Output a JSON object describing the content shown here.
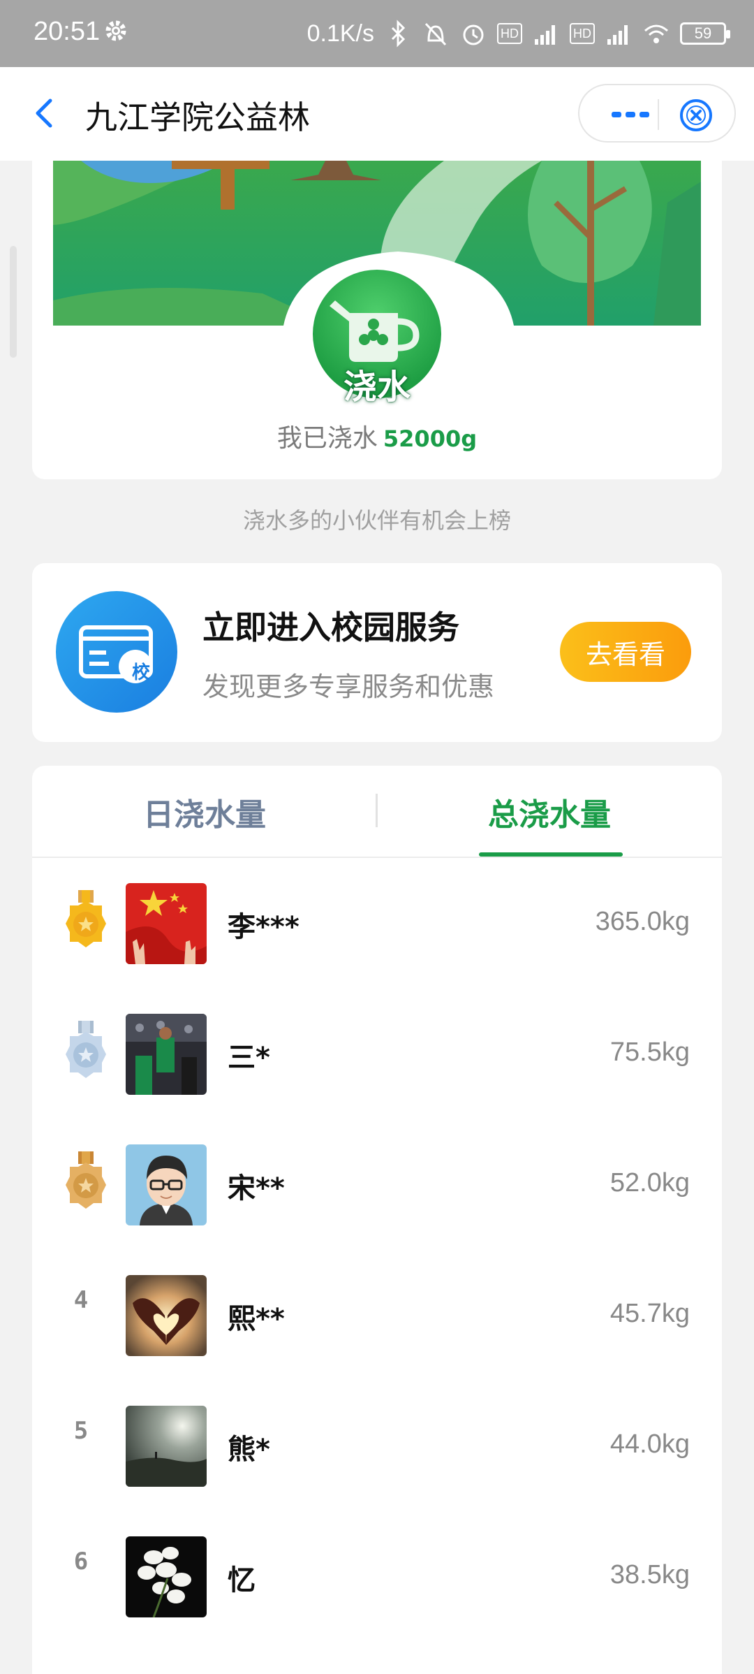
{
  "status_bar": {
    "time": "20:51",
    "speed": "0.1K/s",
    "battery": "59",
    "hd1": "HD",
    "hd2": "HD",
    "net1": "4G",
    "net2": "4G"
  },
  "nav": {
    "title": "九江学院公益林"
  },
  "forest": {
    "water_label": "浇水",
    "watered_prefix": "我已浇水",
    "watered_amount": "52000g"
  },
  "hint": "浇水多的小伙伴有机会上榜",
  "campus": {
    "title": "立即进入校园服务",
    "subtitle": "发现更多专享服务和优惠",
    "button": "去看看",
    "icon_char": "校"
  },
  "tabs": [
    {
      "label": "日浇水量"
    },
    {
      "label": "总浇水量"
    }
  ],
  "active_tab": 1,
  "ranking": [
    {
      "rank": "1",
      "name": "李***",
      "amount": "365.0kg",
      "medal": "gold"
    },
    {
      "rank": "2",
      "name": "三*",
      "amount": "75.5kg",
      "medal": "silver"
    },
    {
      "rank": "3",
      "name": "宋**",
      "amount": "52.0kg",
      "medal": "bronze"
    },
    {
      "rank": "4",
      "name": "熙**",
      "amount": "45.7kg"
    },
    {
      "rank": "5",
      "name": "熊*",
      "amount": "44.0kg"
    },
    {
      "rank": "6",
      "name": "忆",
      "amount": "38.5kg"
    }
  ],
  "colors": {
    "green": "#1a9c48",
    "gold": "#f5b81c",
    "silver": "#b9cde3",
    "bronze": "#e0a64a",
    "orange": "#fba013"
  }
}
